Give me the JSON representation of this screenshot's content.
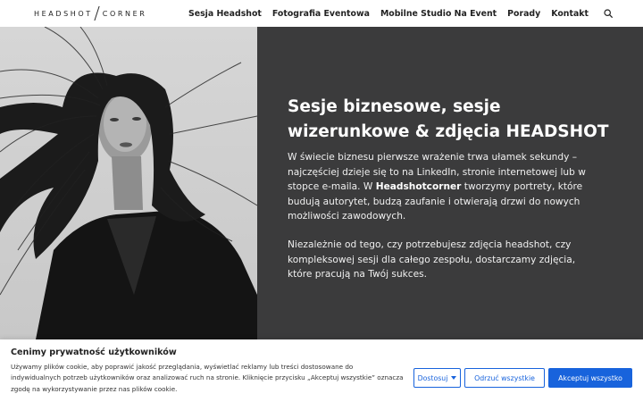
{
  "header": {
    "logo_left": "HEADSHOT",
    "logo_right": "CORNER",
    "nav": [
      "Sesja Headshot",
      "Fotografia Eventowa",
      "Mobilne Studio Na Event",
      "Porady",
      "Kontakt"
    ],
    "search_icon": "search-icon"
  },
  "hero": {
    "title": "Sesje biznesowe, sesje wizerunkowe & zdjęcia HEADSHOT",
    "p1_before": "W świecie biznesu pierwsze wrażenie trwa ułamek sekundy – najczęściej dzieje się to na LinkedIn, stronie internetowej lub w stopce e-maila. W ",
    "p1_bold": "Headshotcorner",
    "p1_after": " tworzymy portrety, które budują autorytet, budzą zaufanie i otwierają drzwi do nowych możliwości zawodowych.",
    "p2": "Niezależnie od tego, czy potrzebujesz zdjęcia headshot, czy kompleksowej sesji dla całego zespołu, dostarczamy zdjęcia, które pracują na Twój sukces.",
    "colors": {
      "panel": "#3b3b3c",
      "text": "#ffffff"
    }
  },
  "cookie": {
    "title": "Cenimy prywatność użytkowników",
    "text": "Używamy plików cookie, aby poprawić jakość przeglądania, wyświetlać reklamy lub treści dostosowane do indywidualnych potrzeb użytkowników oraz analizować ruch na stronie. Kliknięcie przycisku „Akceptuj wszystkie” oznacza zgodę na wykorzystywanie przez nas plików cookie.",
    "btn_customize": "Dostosuj",
    "btn_reject": "Odrzuć wszystkie",
    "btn_accept": "Akceptuj wszystko",
    "colors": {
      "accent": "#1863dc"
    }
  }
}
